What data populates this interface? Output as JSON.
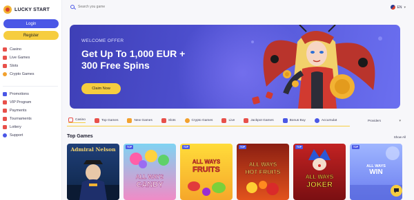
{
  "brand": {
    "name": "LUCKY START"
  },
  "auth": {
    "login_label": "Login",
    "register_label": "Register"
  },
  "sidebar": {
    "main_items": [
      {
        "label": "Casino",
        "icon": "casino-icon",
        "color": "#e8504a"
      },
      {
        "label": "Live Games",
        "icon": "live-icon",
        "color": "#e8504a"
      },
      {
        "label": "Slots",
        "icon": "slots-icon",
        "color": "#e8504a"
      },
      {
        "label": "Crypto Games",
        "icon": "crypto-icon",
        "color": "#f2a12e"
      }
    ],
    "secondary_items": [
      {
        "label": "Promotions",
        "icon": "promotions-icon",
        "color": "#4a57e6"
      },
      {
        "label": "VIP Program",
        "icon": "vip-icon",
        "color": "#e8504a"
      },
      {
        "label": "Payments",
        "icon": "payments-icon",
        "color": "#e8504a"
      },
      {
        "label": "Tournaments",
        "icon": "tournaments-icon",
        "color": "#e8504a"
      },
      {
        "label": "Lottery",
        "icon": "lottery-icon",
        "color": "#e8504a"
      },
      {
        "label": "Support",
        "icon": "support-icon",
        "color": "#4a57e6"
      }
    ]
  },
  "search": {
    "placeholder": "Search you game"
  },
  "language": {
    "code": "EN"
  },
  "banner": {
    "eyebrow": "WELCOME OFFER",
    "headline_line1": "Get Up To 1,000 EUR +",
    "headline_line2": "300 Free Spins",
    "cta": "Claim Now"
  },
  "categories": [
    {
      "label": "Casino",
      "icon": "casino-icon",
      "color": "#e8504a"
    },
    {
      "label": "Top Games",
      "icon": "top-games-icon",
      "color": "#e8504a"
    },
    {
      "label": "New Games",
      "icon": "new-games-icon",
      "color": "#f2a12e"
    },
    {
      "label": "Slots",
      "icon": "slots-icon",
      "color": "#e8504a"
    },
    {
      "label": "Crypto Games",
      "icon": "crypto-icon",
      "color": "#f2a12e"
    },
    {
      "label": "Live",
      "icon": "live-icon",
      "color": "#e8504a"
    },
    {
      "label": "Jackpot Games",
      "icon": "jackpot-icon",
      "color": "#e8504a"
    },
    {
      "label": "Bonus Buy",
      "icon": "bonus-buy-icon",
      "color": "#4a57e6"
    },
    {
      "label": "Accumulat",
      "icon": "accumulator-icon",
      "color": "#4a57e6"
    }
  ],
  "providers": {
    "label": "Providers"
  },
  "section": {
    "title": "Top Games",
    "show_all": "Show All"
  },
  "games": [
    {
      "line1": "Admiral Nelson",
      "line2": "",
      "badge": ""
    },
    {
      "line1": "ALL WAYS",
      "line2": "CANDY",
      "badge": "TOP"
    },
    {
      "line1": "ALL WAYS",
      "line2": "FRUITS",
      "badge": "TOP"
    },
    {
      "line1": "ALL WAYS",
      "line2": "HOT FRUITS",
      "badge": "TOP"
    },
    {
      "line1": "ALL WAYS",
      "line2": "JOKER",
      "badge": "TOP"
    },
    {
      "line1": "ALL WAYS",
      "line2": "WIN",
      "badge": "TOP"
    }
  ],
  "colors": {
    "accent": "#4a57e6",
    "gold": "#f6cd3f",
    "banner": "#4e50d0"
  }
}
